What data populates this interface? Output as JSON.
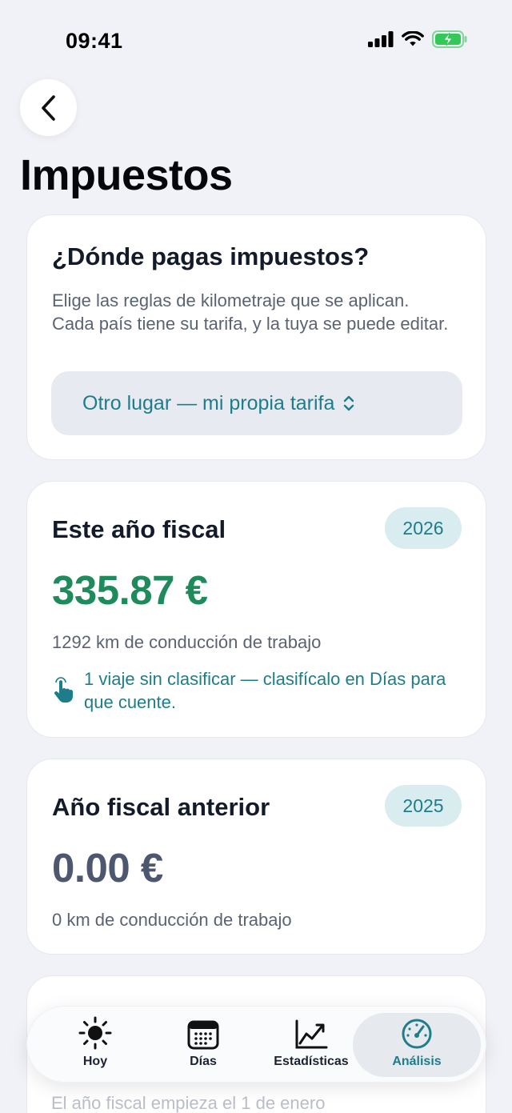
{
  "status_bar": {
    "time": "09:41"
  },
  "header": {
    "title": "Impuestos"
  },
  "country_card": {
    "heading": "¿Dónde pagas impuestos?",
    "description": "Elige las reglas de kilometraje que se aplican. Cada país tiene su tarifa, y la tuya se puede editar.",
    "picker_value": "Otro lugar — mi propia tarifa"
  },
  "current_year": {
    "heading": "Este año fiscal",
    "year": "2026",
    "amount": "335.87 €",
    "distance": "1292 km de conducción de trabajo",
    "notice": "1 viaje sin clasificar — clasifícalo en Días para que cuente.",
    "amount_color": "#1f8a5b"
  },
  "previous_year": {
    "heading": "Año fiscal anterior",
    "year": "2025",
    "amount": "0.00 €",
    "distance": "0 km de conducción de trabajo",
    "amount_color": "#4d5870"
  },
  "partial_card": {
    "footer_text": "El año fiscal empieza el 1 de enero"
  },
  "tabs": [
    {
      "label": "Hoy",
      "icon": "sun-icon"
    },
    {
      "label": "Días",
      "icon": "calendar-icon"
    },
    {
      "label": "Estadísticas",
      "icon": "chart-line-icon"
    },
    {
      "label": "Análisis",
      "icon": "gauge-icon",
      "active": true
    }
  ],
  "colors": {
    "accent": "#1e7d8a",
    "positive": "#1f8a5b",
    "battery": "#34c759"
  }
}
